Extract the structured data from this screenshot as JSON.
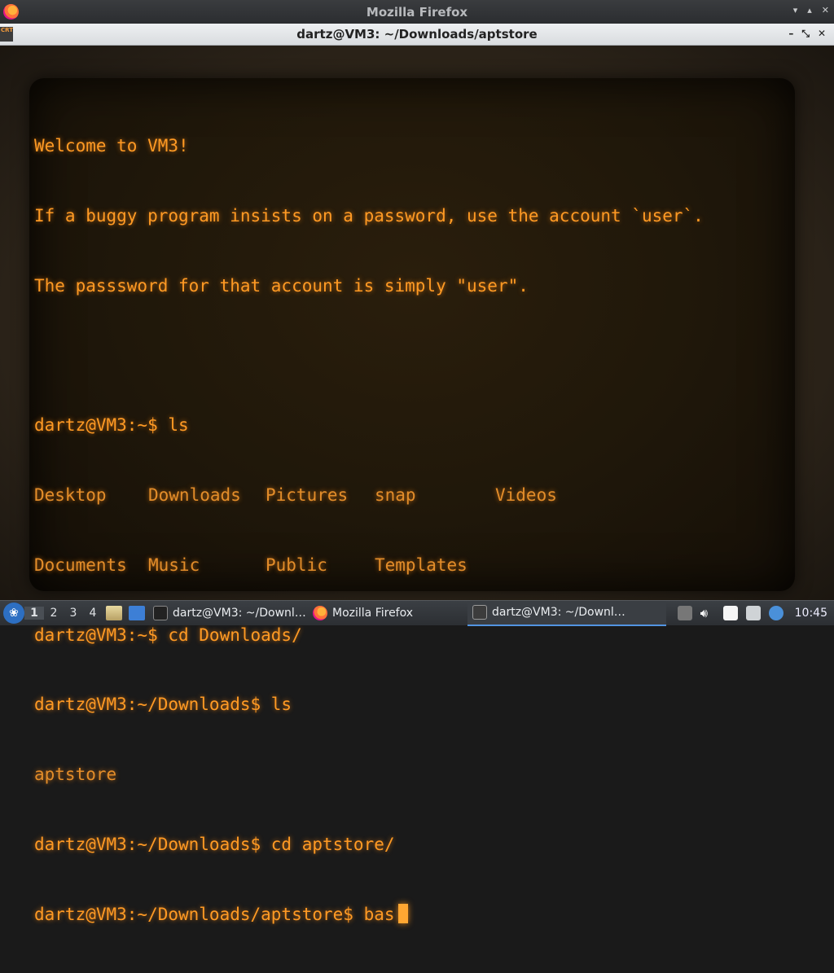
{
  "firefox": {
    "title": "Mozilla Firefox",
    "controls": [
      "▾",
      "▴",
      "✕"
    ]
  },
  "terminal_window": {
    "title": "dartz@VM3: ~/Downloads/aptstore",
    "icon_text": "CRT",
    "controls": [
      "–",
      "⤡",
      "✕"
    ]
  },
  "terminal": {
    "lines": [
      "Welcome to VM3!",
      "If a buggy program insists on a password, use the account `user`.",
      "The passsword for that account is simply \"user\".",
      "",
      "dartz@VM3:~$ ls"
    ],
    "ls_row1": [
      "Desktop",
      "Downloads",
      "Pictures",
      "snap",
      "Videos"
    ],
    "ls_row2": [
      "Documents",
      "Music",
      "Public",
      "Templates"
    ],
    "lines2": [
      "dartz@VM3:~$ cd Downloads/",
      "dartz@VM3:~/Downloads$ ls",
      "aptstore",
      "dartz@VM3:~/Downloads$ cd aptstore/"
    ],
    "current_prompt": "dartz@VM3:~/Downloads/aptstore$ bas"
  },
  "taskbar": {
    "workspaces": [
      "1",
      "2",
      "3",
      "4"
    ],
    "active_workspace": "1",
    "tasks": [
      {
        "label": "dartz@VM3: ~/Downl…",
        "icon": "terminal-icon",
        "active": false
      },
      {
        "label": "Mozilla Firefox",
        "icon": "firefox-icon",
        "active": false
      },
      {
        "label": "dartz@VM3: ~/Downl…",
        "icon": "crt-icon",
        "active": true
      }
    ],
    "clock": "10:45"
  }
}
